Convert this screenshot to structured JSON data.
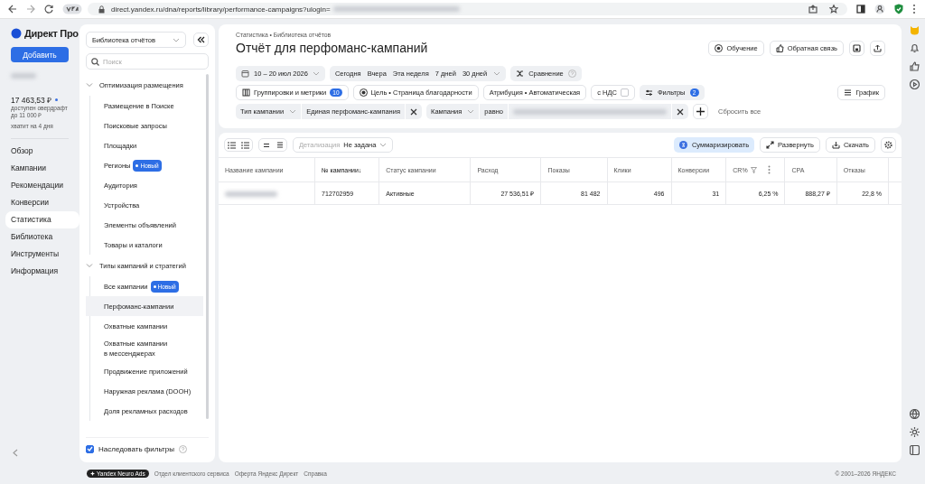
{
  "browser": {
    "url": "direct.yandex.ru/dna/reports/library/performance-campaigns?ulogin="
  },
  "app_nav": {
    "logo": "Директ Про",
    "add_button": "Добавить",
    "balance": "17 463,53 ₽",
    "overdraft": "доступен овердрафт",
    "overdraft_limit": "до 11 000 ₽",
    "days_left": "хватит на 4 дня",
    "items": [
      {
        "label": "Обзор",
        "selected": false
      },
      {
        "label": "Кампании",
        "selected": false
      },
      {
        "label": "Рекомендации",
        "selected": false
      },
      {
        "label": "Конверсии",
        "selected": false
      },
      {
        "label": "Статистика",
        "selected": true
      },
      {
        "label": "Библиотека",
        "selected": false
      },
      {
        "label": "Инструменты",
        "selected": false
      },
      {
        "label": "Информация",
        "selected": false
      }
    ]
  },
  "library": {
    "selector": "Библиотека отчётов",
    "search_placeholder": "Поиск",
    "groups": [
      {
        "label": "Оптимизация размещения",
        "expanded": true,
        "children": [
          {
            "label": "Размещение в Поиске",
            "selected": false
          },
          {
            "label": "Поисковые запросы",
            "selected": false
          },
          {
            "label": "Площадки",
            "selected": false
          },
          {
            "label": "Регионы",
            "badge": "Новый",
            "selected": false
          },
          {
            "label": "Аудитория",
            "selected": false
          },
          {
            "label": "Устройства",
            "selected": false
          },
          {
            "label": "Элементы объявлений",
            "selected": false
          },
          {
            "label": "Товары и каталоги",
            "selected": false
          }
        ]
      },
      {
        "label": "Типы кампаний и стратегий",
        "expanded": true,
        "children": [
          {
            "label": "Все кампании",
            "badge": "Новый",
            "selected": false
          },
          {
            "label": "Перфоманс-кампании",
            "selected": true
          },
          {
            "label": "Охватные кампании",
            "selected": false
          },
          {
            "label": "Охватные кампании\nв мессенджерах",
            "selected": false
          },
          {
            "label": "Продвижение приложений",
            "selected": false
          },
          {
            "label": "Наружная реклама (DOOH)",
            "selected": false
          },
          {
            "label": "Доля рекламных расходов",
            "selected": false
          }
        ]
      }
    ],
    "inherit_filters": {
      "label": "Наследовать фильтры",
      "checked": true
    }
  },
  "report": {
    "breadcrumbs": "Статистика • Библиотека отчётов",
    "title": "Отчёт для перфоманс-кампаний",
    "header_buttons": [
      {
        "kind": "learn",
        "label": "Обучение"
      },
      {
        "kind": "feedback",
        "label": "Обратная связь"
      },
      {
        "kind": "save"
      },
      {
        "kind": "share"
      }
    ],
    "date_range": "10 – 20 июл 2026",
    "periods": [
      "Сегодня",
      "Вчера",
      "Эта неделя",
      "7 дней",
      "30 дней"
    ],
    "compare": "Сравнение",
    "settings": [
      {
        "kind": "groupings",
        "label": "Группировки и метрики",
        "count": "10"
      },
      {
        "kind": "goal",
        "label": "Цель • Страница благодарности"
      },
      {
        "kind": "plain",
        "label": "Атрибуция • Автоматическая"
      },
      {
        "kind": "vat",
        "label": "с НДС",
        "checked": false
      },
      {
        "kind": "filters",
        "label": "Фильтры",
        "count": "2"
      }
    ],
    "chart_button": "График",
    "filters": [
      {
        "field": "Тип кампании",
        "value": "Единая перфоманс-кампания"
      },
      {
        "field": "Кампания",
        "operator": "равно",
        "value_hidden": true
      }
    ],
    "reset": "Сбросить все",
    "table_toolbar": {
      "detail_label": "Детализация",
      "detail_value": "Не задана",
      "summarize": "Суммаризировать",
      "summarize_on": true,
      "expand": "Развернуть",
      "download": "Скачать"
    },
    "table": {
      "columns": [
        {
          "label": "Название кампании",
          "sorted": false
        },
        {
          "label": "№ кампании↓",
          "sorted": true
        },
        {
          "label": "Статус кампании",
          "sorted": false
        },
        {
          "label": "Расход",
          "sorted": false
        },
        {
          "label": "Показы",
          "sorted": false
        },
        {
          "label": "Клики",
          "sorted": false
        },
        {
          "label": "Конверсии",
          "sorted": false
        },
        {
          "label": "CR%",
          "sorted": false,
          "filter": true
        },
        {
          "label": "CPA",
          "sorted": false
        },
        {
          "label": "Отказы",
          "sorted": false
        }
      ],
      "rows": [
        {
          "cells": [
            null,
            "712702959",
            "Активные",
            "27 536,51 ₽",
            "81 482",
            "496",
            "31",
            "6,25 %",
            "888,27 ₽",
            "22,8 %"
          ]
        }
      ]
    }
  },
  "footer": {
    "badge": "Yandex Neuro Ads",
    "links": [
      "Отдел клиентского сервиса",
      "Оферта Яндекс Директ",
      "Справка"
    ],
    "copyright": "© 2001–2026 ЯНДЕКС"
  }
}
